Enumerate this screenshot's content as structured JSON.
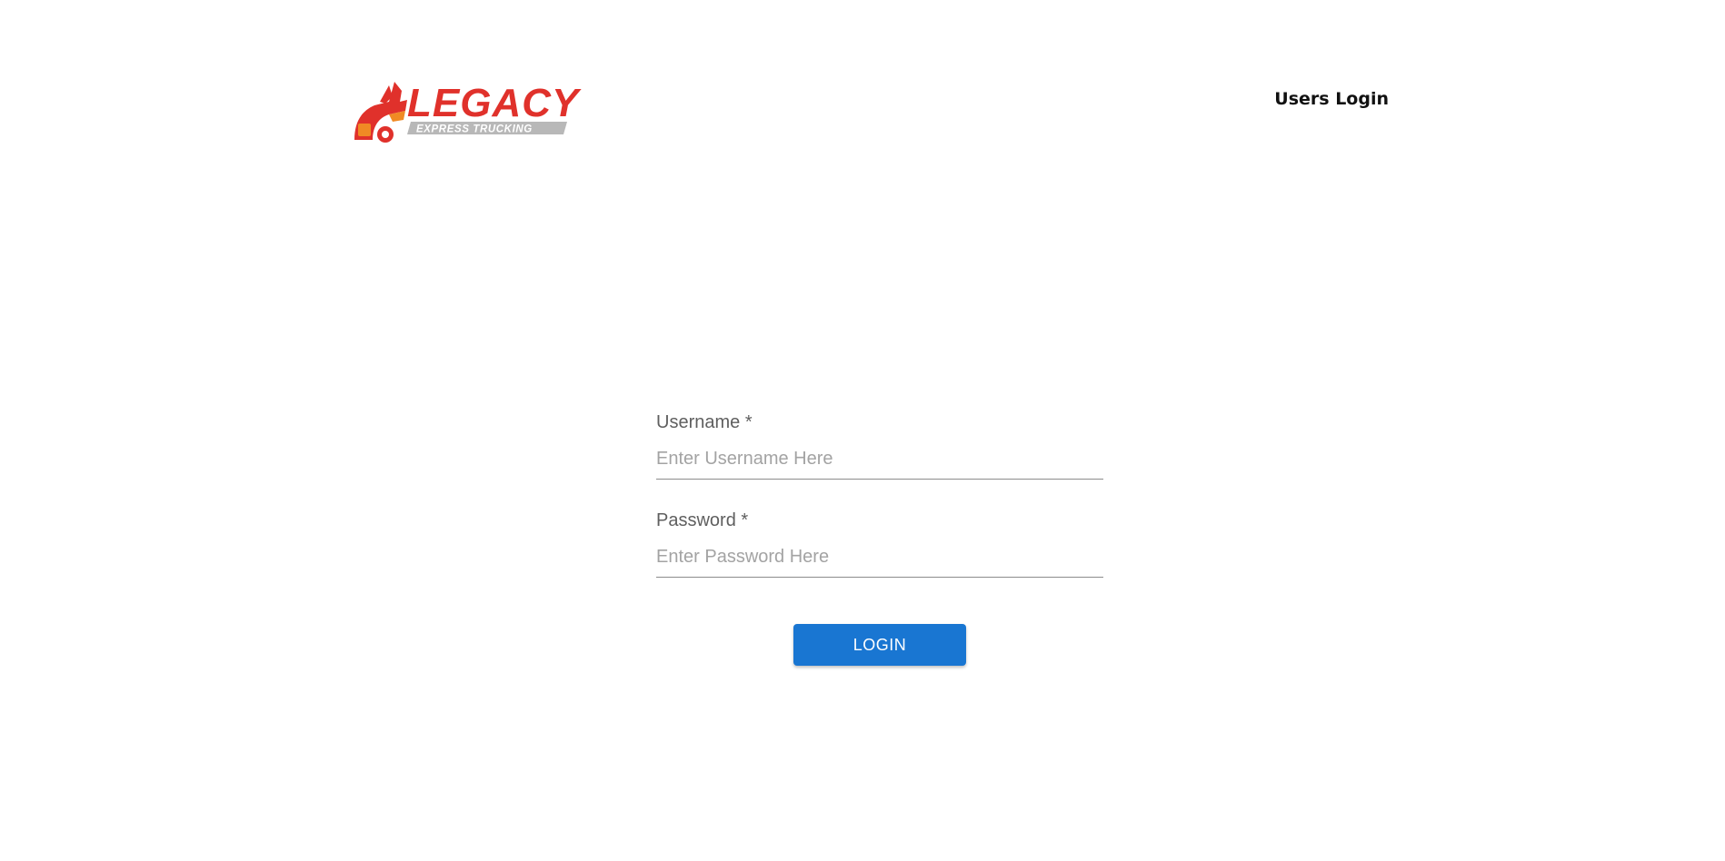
{
  "header": {
    "logo": {
      "word": "LEGACY",
      "tagline": "EXPRESS TRUCKING",
      "icon": "truck-flame-icon",
      "colors": {
        "red": "#e0312b",
        "orange": "#f08a24",
        "gray": "#9a9a9a"
      }
    },
    "title": "Users Login"
  },
  "form": {
    "username": {
      "label": "Username *",
      "placeholder": "Enter Username Here",
      "value": ""
    },
    "password": {
      "label": "Password *",
      "placeholder": "Enter Password Here",
      "value": ""
    },
    "login_label": "LOGIN"
  },
  "colors": {
    "accent": "#1976d2",
    "label": "#5f5f5f",
    "placeholder": "#a3a3a3"
  }
}
